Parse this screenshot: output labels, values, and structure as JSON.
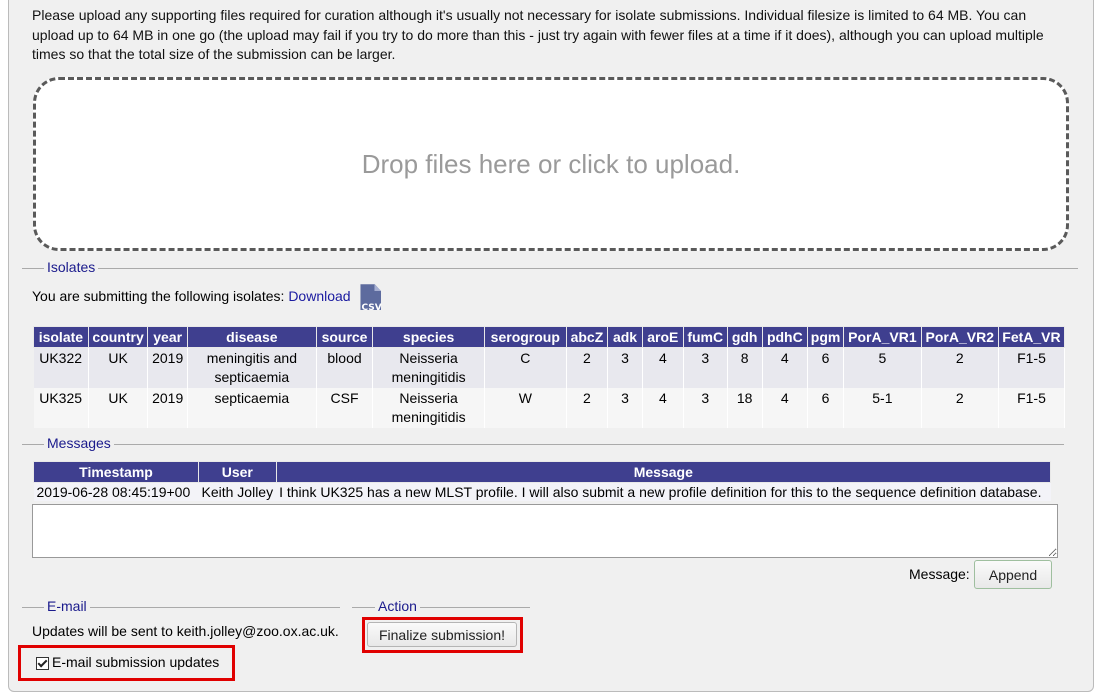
{
  "intro": "Please upload any supporting files required for curation although it's usually not necessary for isolate submissions. Individual filesize is limited to 64 MB. You can upload up to 64 MB in one go (the upload may fail if you try to do more than this - just try again with fewer files at a time if it does), although you can upload multiple times so that the total size of the submission can be larger.",
  "dropzone": {
    "text": "Drop files here or click to upload."
  },
  "isolates": {
    "legend": "Isolates",
    "intro": "You are submitting the following isolates:",
    "download_label": "Download",
    "csv_icon_text": "CSV",
    "columns": [
      "isolate",
      "country",
      "year",
      "disease",
      "source",
      "species",
      "serogroup",
      "abcZ",
      "adk",
      "aroE",
      "fumC",
      "gdh",
      "pdhC",
      "pgm",
      "PorA_VR1",
      "PorA_VR2",
      "FetA_VR"
    ],
    "rows": [
      [
        "UK322",
        "UK",
        "2019",
        "meningitis and septicaemia",
        "blood",
        "Neisseria meningitidis",
        "C",
        "2",
        "3",
        "4",
        "3",
        "8",
        "4",
        "6",
        "5",
        "2",
        "F1-5"
      ],
      [
        "UK325",
        "UK",
        "2019",
        "septicaemia",
        "CSF",
        "Neisseria meningitidis",
        "W",
        "2",
        "3",
        "4",
        "3",
        "18",
        "4",
        "6",
        "5-1",
        "2",
        "F1-5"
      ]
    ]
  },
  "messages": {
    "legend": "Messages",
    "columns": [
      "Timestamp",
      "User",
      "Message"
    ],
    "rows": [
      [
        "2019-06-28 08:45:19+00",
        "Keith Jolley",
        "I think UK325 has a new MLST profile. I will also submit a new profile definition for this to the sequence definition database."
      ]
    ],
    "input_label": "Message:",
    "append_label": "Append"
  },
  "email": {
    "legend": "E-mail",
    "text": "Updates will be sent to keith.jolley@zoo.ox.ac.uk.",
    "checkbox_label": "E-mail submission updates",
    "checked": true
  },
  "action": {
    "legend": "Action",
    "finalize_label": "Finalize submission!"
  },
  "colors": {
    "header_bg": "#3f3f8f",
    "highlight": "#e00000",
    "legend": "#1a1a8c"
  }
}
